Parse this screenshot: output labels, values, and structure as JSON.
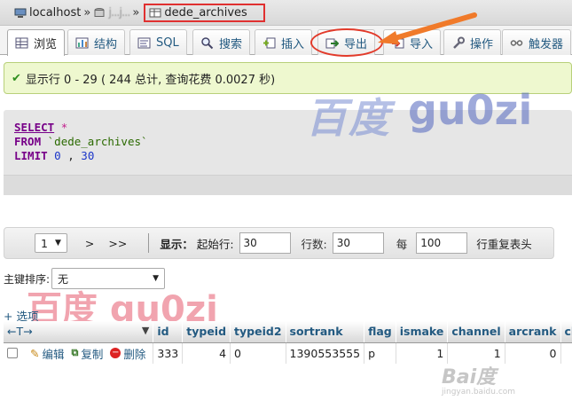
{
  "breadcrumb": {
    "server": "localhost",
    "database_blurred": "j...j...",
    "table": "dede_archives",
    "sep": "»"
  },
  "tabs": [
    {
      "label": "浏览",
      "icon": "browse-icon"
    },
    {
      "label": "结构",
      "icon": "structure-icon"
    },
    {
      "label": "SQL",
      "icon": "sql-icon"
    },
    {
      "label": "搜索",
      "icon": "search-icon"
    },
    {
      "label": "插入",
      "icon": "insert-icon"
    },
    {
      "label": "导出",
      "icon": "export-icon"
    },
    {
      "label": "导入",
      "icon": "import-icon"
    },
    {
      "label": "操作",
      "icon": "wrench-icon"
    },
    {
      "label": "触发器",
      "icon": "trigger-icon"
    }
  ],
  "success": {
    "message": "显示行 0 - 29 ( 244 总计, 查询花费 0.0027 秒)"
  },
  "sql": {
    "select": "SELECT",
    "star": "*",
    "from": "FROM",
    "table": "`dede_archives`",
    "limit": "LIMIT",
    "offset": "0",
    "comma": ",",
    "count": "30"
  },
  "watermarks": {
    "top_cn": "百度",
    "top_en": "gu0zi",
    "mid": "百度  gu0zi",
    "bottom": "Bai度",
    "bottom_sub": "jingyan.baidu.com"
  },
  "nav": {
    "page": "1",
    "next": ">",
    "last": ">>",
    "show_label": "显示：",
    "start_label": "起始行:",
    "start_value": "30",
    "rows_label": "行数:",
    "rows_value": "30",
    "every_label": "每",
    "every_value": "100",
    "repeat_label": "行重复表头"
  },
  "sort": {
    "label": "主键排序:",
    "value": "无"
  },
  "options_link": "+ 选项",
  "table": {
    "headers": [
      "id",
      "typeid",
      "typeid2",
      "sortrank",
      "flag",
      "ismake",
      "channel",
      "arcrank",
      "cli"
    ],
    "row": {
      "edit": "编辑",
      "copy": "复制",
      "delete": "删除",
      "cells": [
        "333",
        "4",
        "0",
        "1390553555",
        "p",
        "1",
        "1",
        "0",
        ""
      ]
    }
  }
}
